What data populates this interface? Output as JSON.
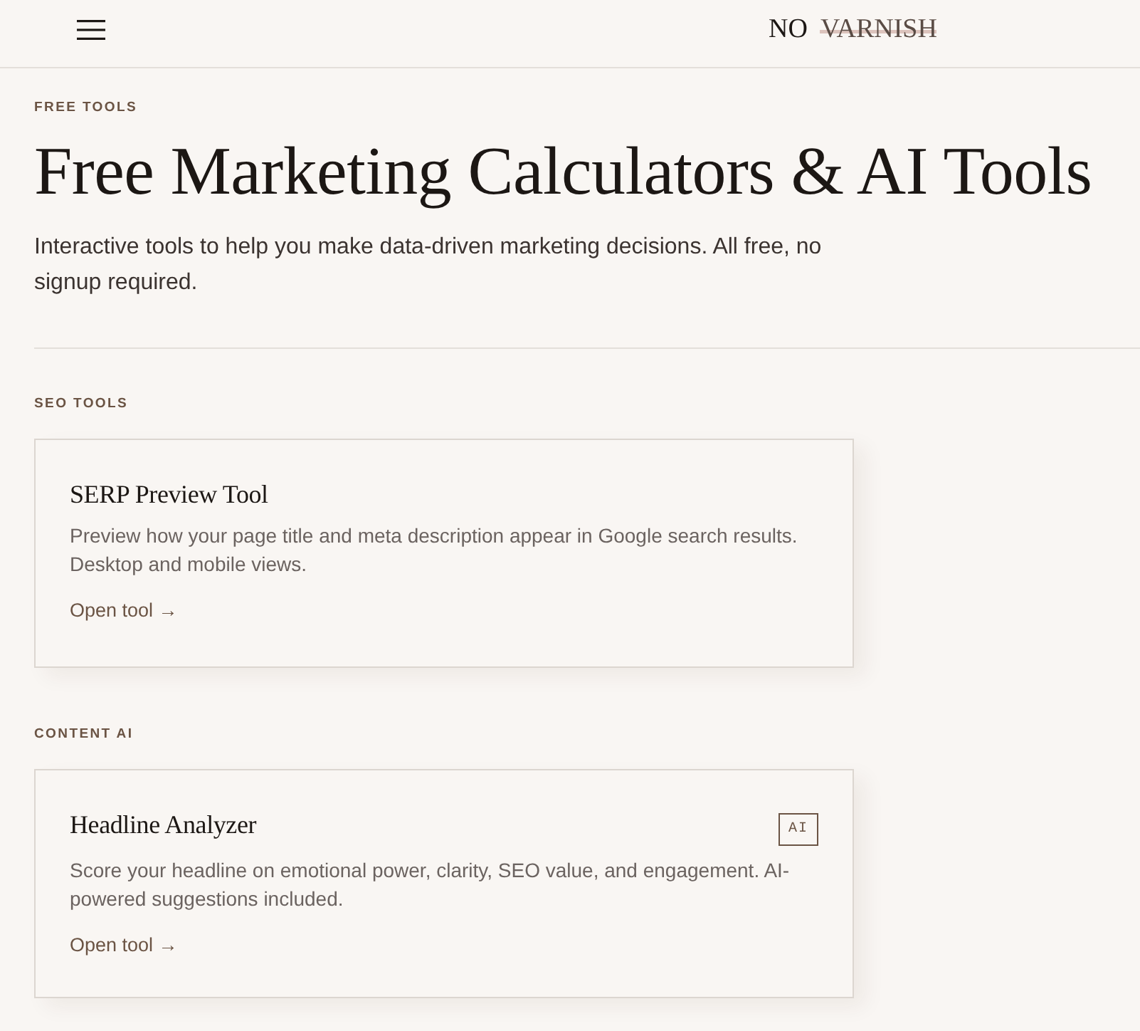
{
  "header": {
    "logo": {
      "first_word": "NO",
      "struck_word": "VARNISH"
    }
  },
  "hero": {
    "eyebrow": "FREE TOOLS",
    "title": "Free Marketing Calculators & AI Tools",
    "subtitle": "Interactive tools to help you make data-driven marketing decisions. All free, no signup required."
  },
  "sections": [
    {
      "label": "SEO TOOLS",
      "tools": [
        {
          "title": "SERP Preview Tool",
          "description": "Preview how your page title and meta description appear in Google search results. Desktop and mobile views.",
          "link": "Open tool →"
        }
      ]
    },
    {
      "label": "CONTENT AI",
      "tools": [
        {
          "title": "Headline Analyzer",
          "badge": "AI",
          "description": "Score your headline on emotional power, clarity, SEO value, and engagement. AI-powered suggestions included.",
          "link": "Open tool →"
        }
      ]
    }
  ]
}
